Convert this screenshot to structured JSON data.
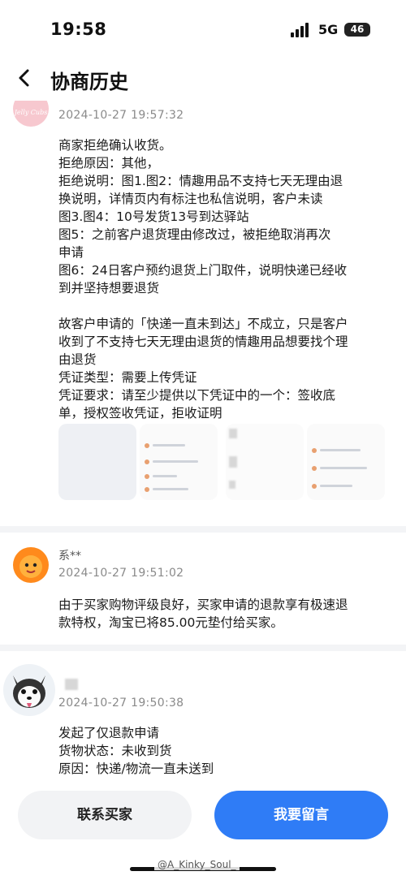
{
  "status": {
    "time": "19:58",
    "network": "5G",
    "battery": "46"
  },
  "nav": {
    "title": "协商历史"
  },
  "entries": [
    {
      "avatar_text": "Jelly Cubs",
      "timestamp": "2024-10-27 19:57:32",
      "lines": [
        "商家拒绝确认收货。",
        "拒绝原因：其他，",
        "拒绝说明：图1.图2：情趣用品不支持七天无理由退",
        "换说明，详情页内有标注也私信说明，客户未读",
        "图3.图4：10号发货13号到达驿站",
        "图5：之前客户退货理由修改过，被拒绝取消再次",
        "申请",
        "图6：24日客户预约退货上门取件，说明快递已经收",
        "到并坚持想要退货",
        "",
        "故客户申请的「快递一直未到达」不成立，只是客户",
        "收到了不支持七天无理由退货的情趣用品想要找个理",
        "由退货",
        "凭证类型：需要上传凭证",
        "凭证要求：请至少提供以下凭证中的一个：签收底",
        "单，授权签收凭证，拒收证明"
      ]
    },
    {
      "name": "系**",
      "timestamp": "2024-10-27 19:51:02",
      "lines": [
        "由于买家购物评级良好，买家申请的退款享有极速退",
        "款特权，淘宝已将85.00元垫付给买家。"
      ]
    },
    {
      "name": "",
      "timestamp": "2024-10-27 19:50:38",
      "lines": [
        "发起了仅退款申请",
        "货物状态：未收到货",
        "原因：快递/物流一直未送到"
      ]
    }
  ],
  "buttons": {
    "contact": "联系买家",
    "reply": "我要留言"
  },
  "watermark": "@A_Kinky_Soul_",
  "colors": {
    "accent": "#2f7cf6",
    "secondary_bg": "#f2f3f5"
  },
  "icons": [
    "back-icon",
    "signal-icon",
    "battery-icon",
    "merchant-avatar",
    "system-avatar",
    "buyer-avatar"
  ]
}
